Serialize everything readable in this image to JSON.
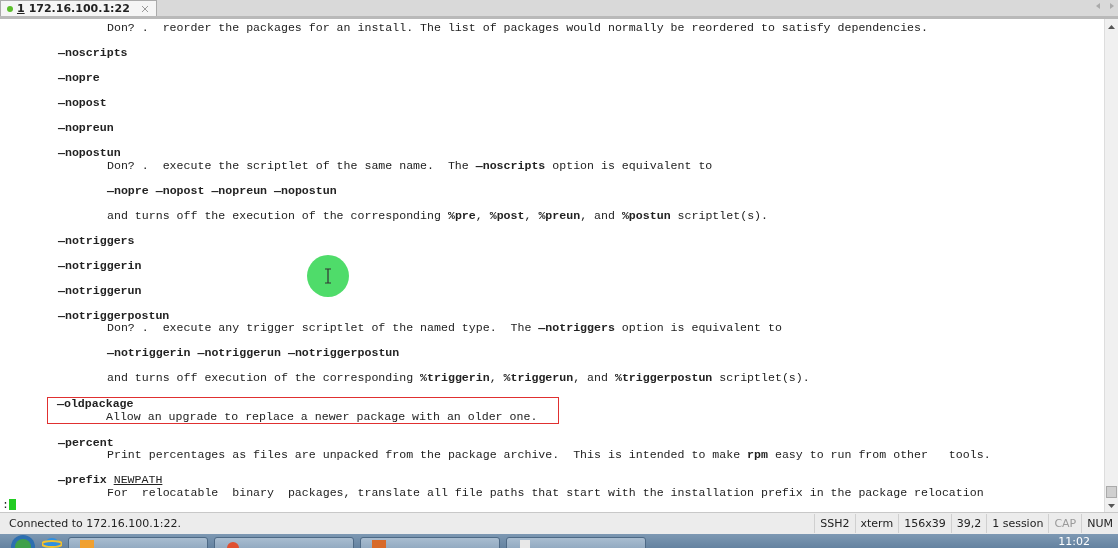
{
  "tabs": [
    {
      "number": "1",
      "label": "172.16.100.1:22",
      "selected": true,
      "connected": true
    }
  ],
  "terminal": {
    "lines": [
      {
        "kind": "body",
        "text": "Don? .  reorder the packages for an install. The list of packages would normally be reordered to satisfy dependencies."
      },
      {
        "kind": "blank"
      },
      {
        "kind": "option",
        "text": "**—noscripts**"
      },
      {
        "kind": "blank"
      },
      {
        "kind": "option",
        "text": "**—nopre**"
      },
      {
        "kind": "blank"
      },
      {
        "kind": "option",
        "text": "**—nopost**"
      },
      {
        "kind": "blank"
      },
      {
        "kind": "option",
        "text": "**—nopreun**"
      },
      {
        "kind": "blank"
      },
      {
        "kind": "option",
        "text": "**—nopostun**"
      },
      {
        "kind": "body",
        "text": "Don? .  execute the scriptlet of the same name.  The **—noscripts** option is equivalent to"
      },
      {
        "kind": "blank"
      },
      {
        "kind": "body",
        "text": "**—nopre** **—nopost** **—nopreun** **—nopostun**"
      },
      {
        "kind": "blank"
      },
      {
        "kind": "body",
        "text": "and turns off the execution of the corresponding **%pre**, **%post**, **%preun**, and **%postun** scriptlet(s)."
      },
      {
        "kind": "blank"
      },
      {
        "kind": "option",
        "text": "**—notriggers**"
      },
      {
        "kind": "blank"
      },
      {
        "kind": "option",
        "text": "**—notriggerin**"
      },
      {
        "kind": "blank"
      },
      {
        "kind": "option",
        "text": "**—notriggerun**"
      },
      {
        "kind": "blank"
      },
      {
        "kind": "option",
        "text": "**—notriggerpostun**"
      },
      {
        "kind": "body",
        "text": "Don? .  execute any trigger scriptlet of the named type.  The **—notriggers** option is equivalent to"
      },
      {
        "kind": "blank"
      },
      {
        "kind": "body",
        "text": "**—notriggerin** **—notriggerun** **—notriggerpostun**"
      },
      {
        "kind": "blank"
      },
      {
        "kind": "body",
        "text": "and turns off execution of the corresponding **%triggerin**, **%triggerun**, and **%triggerpostun** scriptlet(s)."
      },
      {
        "kind": "blank"
      },
      {
        "kind": "option",
        "text": "**—oldpackage**",
        "highlighted": true
      },
      {
        "kind": "body",
        "text": "Allow an upgrade to replace a newer package with an older one.",
        "highlighted": true
      },
      {
        "kind": "blank"
      },
      {
        "kind": "option",
        "text": "**—percent**"
      },
      {
        "kind": "body",
        "text": "Print percentages as files are unpacked from the package archive.  This is intended to make **rpm** easy to run from other   tools."
      },
      {
        "kind": "blank"
      },
      {
        "kind": "option",
        "text": "**—prefix**",
        "argument": "NEWPATH"
      },
      {
        "kind": "body",
        "text": "For  relocatable  binary  packages, translate all file paths that start with the installation prefix in the package relocation"
      },
      {
        "kind": "prompt",
        "text": ":"
      }
    ]
  },
  "status_bar": {
    "message": "Connected to 172.16.100.1:22.",
    "cells": [
      {
        "text": "SSH2",
        "disabled": false
      },
      {
        "text": "xterm",
        "disabled": false
      },
      {
        "text": "156x39",
        "disabled": false
      },
      {
        "text": "39,2",
        "disabled": false
      },
      {
        "text": "1 session",
        "disabled": false
      },
      {
        "text": "CAP",
        "disabled": true
      },
      {
        "text": "NUM",
        "disabled": false
      }
    ]
  },
  "taskbar": {
    "clock": "11:02"
  }
}
